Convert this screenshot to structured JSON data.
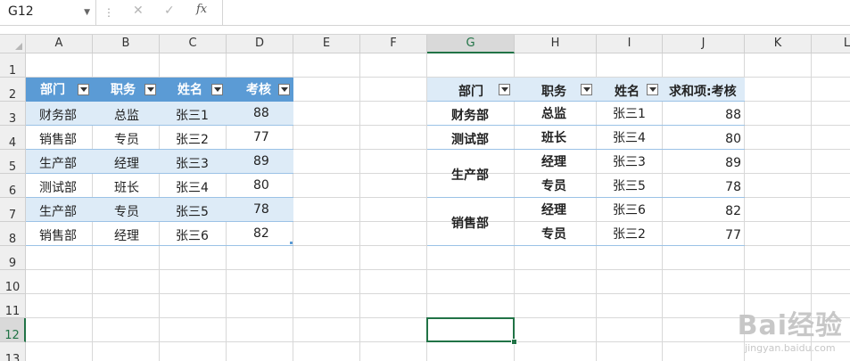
{
  "name_box": "G12",
  "formula": {
    "fx_label": "fx",
    "cancel_glyph": "✕",
    "enter_glyph": "✓",
    "separator_glyph": "⋮"
  },
  "columns": [
    "A",
    "B",
    "C",
    "D",
    "E",
    "F",
    "G",
    "H",
    "I",
    "J",
    "K",
    "L"
  ],
  "rows": [
    "1",
    "2",
    "3",
    "4",
    "5",
    "6",
    "7",
    "8",
    "9",
    "10",
    "11",
    "12",
    "13"
  ],
  "active_cell": {
    "column": "G",
    "row": "12"
  },
  "source_table": {
    "headers": [
      "部门",
      "职务",
      "姓名",
      "考核"
    ],
    "rows": [
      [
        "财务部",
        "总监",
        "张三1",
        "88"
      ],
      [
        "销售部",
        "专员",
        "张三2",
        "77"
      ],
      [
        "生产部",
        "经理",
        "张三3",
        "89"
      ],
      [
        "测试部",
        "班长",
        "张三4",
        "80"
      ],
      [
        "生产部",
        "专员",
        "张三5",
        "78"
      ],
      [
        "销售部",
        "经理",
        "张三6",
        "82"
      ]
    ]
  },
  "pivot_table": {
    "headers": [
      "部门",
      "职务",
      "姓名",
      "求和项:考核"
    ],
    "groups": [
      {
        "dept": "财务部",
        "items": [
          {
            "role": "总监",
            "name": "张三1",
            "value": "88"
          }
        ]
      },
      {
        "dept": "测试部",
        "items": [
          {
            "role": "班长",
            "name": "张三4",
            "value": "80"
          }
        ]
      },
      {
        "dept": "生产部",
        "items": [
          {
            "role": "经理",
            "name": "张三3",
            "value": "89"
          },
          {
            "role": "专员",
            "name": "张三5",
            "value": "78"
          }
        ]
      },
      {
        "dept": "销售部",
        "items": [
          {
            "role": "经理",
            "name": "张三6",
            "value": "82"
          },
          {
            "role": "专员",
            "name": "张三2",
            "value": "77"
          }
        ]
      }
    ]
  },
  "colors": {
    "table_header": "#5b9bd5",
    "table_band": "#ddebf7",
    "selection": "#217346"
  },
  "watermark": {
    "main": "Bai经验",
    "sub": "jingyan.baidu.com"
  }
}
